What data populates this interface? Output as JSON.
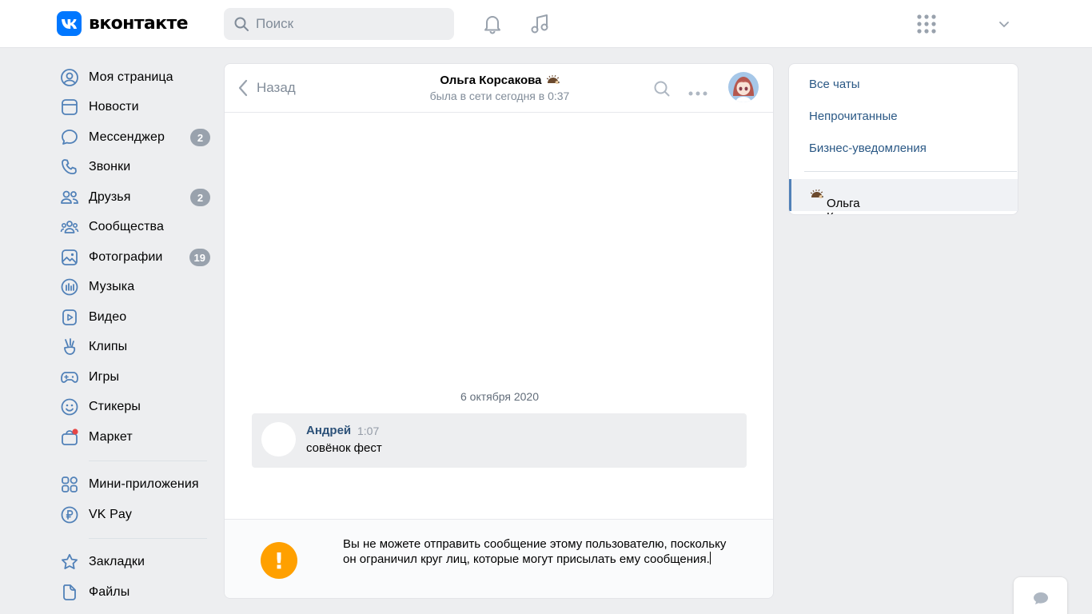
{
  "header": {
    "logo_text": "вконтакте",
    "search_placeholder": "Поиск",
    "icons": [
      "notifications-bell-icon",
      "music-note-icon",
      "apps-grid-icon",
      "chevron-down-icon"
    ]
  },
  "sidebar": {
    "items": [
      {
        "label": "Моя страница",
        "icon": "user-circle-icon"
      },
      {
        "label": "Новости",
        "icon": "newsfeed-icon"
      },
      {
        "label": "Мессенджер",
        "icon": "message-bubble-icon",
        "badge": "2"
      },
      {
        "label": "Звонки",
        "icon": "phone-icon"
      },
      {
        "label": "Друзья",
        "icon": "friends-icon",
        "badge": "2"
      },
      {
        "label": "Сообщества",
        "icon": "communities-icon"
      },
      {
        "label": "Фотографии",
        "icon": "photo-icon",
        "badge": "19"
      },
      {
        "label": "Музыка",
        "icon": "music-icon"
      },
      {
        "label": "Видео",
        "icon": "video-icon"
      },
      {
        "label": "Клипы",
        "icon": "clips-icon"
      },
      {
        "label": "Игры",
        "icon": "gamepad-icon"
      },
      {
        "label": "Стикеры",
        "icon": "smile-icon"
      },
      {
        "label": "Маркет",
        "icon": "market-bag-icon"
      }
    ],
    "extra_items": [
      {
        "label": "Мини-приложения",
        "icon": "mini-apps-icon"
      },
      {
        "label": "VK Pay",
        "icon": "vk-pay-icon"
      }
    ],
    "bottom_items": [
      {
        "label": "Закладки",
        "icon": "star-icon"
      },
      {
        "label": "Файлы",
        "icon": "file-icon"
      }
    ]
  },
  "chat": {
    "back_label": "Назад",
    "peer_name": "Ольга Корсакова",
    "peer_status": "была в сети сегодня в 0:37",
    "date_separator": "6 октября 2020",
    "message": {
      "author": "Андрей",
      "time": "1:07",
      "text": "совёнок фест"
    },
    "notice_text": "Вы не можете отправить сообщение этому пользователю, поскольку он ограничил круг лиц, которые могут присылать ему сообщения.",
    "warning_symbol": "!"
  },
  "filters": {
    "items": [
      {
        "label": "Все чаты"
      },
      {
        "label": "Непрочитанные"
      },
      {
        "label": "Бизнес-уведомления"
      }
    ],
    "active_chat": "Ольга Корсакова"
  },
  "colors": {
    "accent": "#0077ff",
    "link": "#2a5885",
    "badge": "#99a2ad",
    "warning": "#ffa000",
    "background": "#edeef0"
  }
}
